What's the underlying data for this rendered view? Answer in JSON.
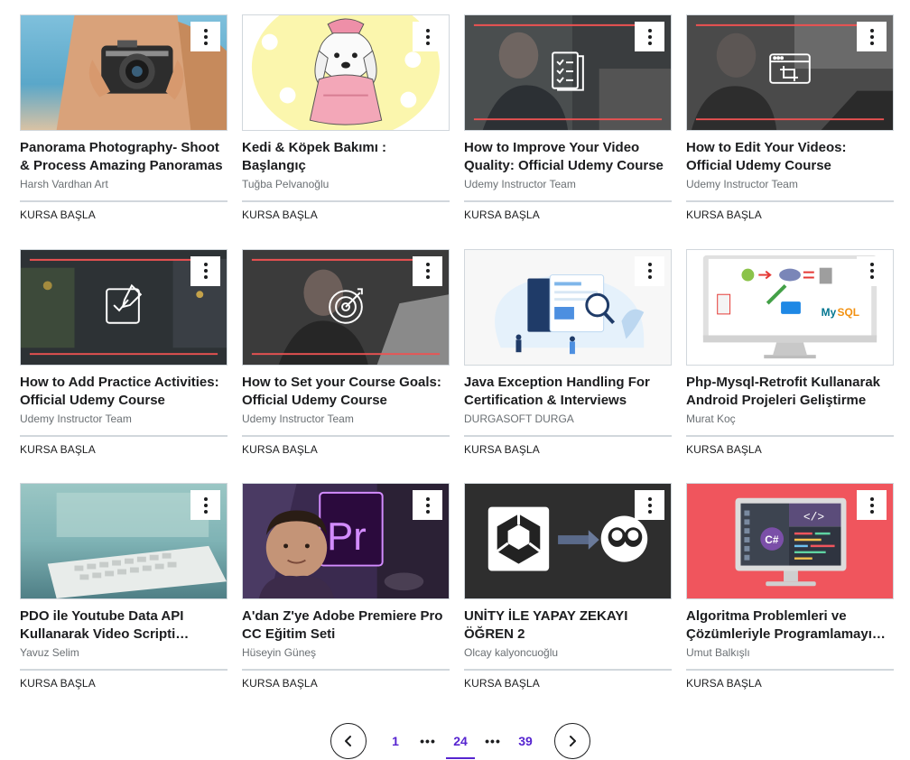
{
  "courses": [
    {
      "title": "Panorama Photography- Shoot & Process Amazing Panoramas",
      "author": "Harsh Vardhan Art",
      "start_label": "KURSA BAŞLA",
      "thumbnail": "camera-photo"
    },
    {
      "title": "Kedi & Köpek Bakımı : Başlangıç",
      "author": "Tuğba Pelvanoğlu",
      "start_label": "KURSA BAŞLA",
      "thumbnail": "dog-illustration"
    },
    {
      "title": "How to Improve Your Video Quality: Official Udemy Course",
      "author": "Udemy Instructor Team",
      "start_label": "KURSA BAŞLA",
      "thumbnail": "checklist-icon"
    },
    {
      "title": "How to Edit Your Videos: Official Udemy Course",
      "author": "Udemy Instructor Team",
      "start_label": "KURSA BAŞLA",
      "thumbnail": "crop-window-icon"
    },
    {
      "title": "How to Add Practice Activities: Official Udemy Course",
      "author": "Udemy Instructor Team",
      "start_label": "KURSA BAŞLA",
      "thumbnail": "edit-note-icon"
    },
    {
      "title": "How to Set your Course Goals: Official Udemy Course",
      "author": "Udemy Instructor Team",
      "start_label": "KURSA BAŞLA",
      "thumbnail": "target-icon"
    },
    {
      "title": "Java Exception Handling For Certification & Interviews",
      "author": "DURGASOFT DURGA",
      "start_label": "KURSA BAŞLA",
      "thumbnail": "search-illustration"
    },
    {
      "title": "Php-Mysql-Retrofit Kullanarak Android Projeleri Geliştirme",
      "author": "Murat Koç",
      "start_label": "KURSA BAŞLA",
      "thumbnail": "php-mysql-diagram"
    },
    {
      "title": "PDO ile Youtube Data API Kullanarak Video Scripti Geliştirme",
      "author": "Yavuz Selim",
      "start_label": "KURSA BAŞLA",
      "thumbnail": "keyboard-photo"
    },
    {
      "title": "A'dan Z'ye Adobe Premiere Pro CC Eğitim Seti",
      "author": "Hüseyin Güneş",
      "start_label": "KURSA BAŞLA",
      "thumbnail": "premiere-logo"
    },
    {
      "title": "UNİTY İLE YAPAY ZEKAYI ÖĞREN 2",
      "author": "Olcay kalyoncuoğlu",
      "start_label": "KURSA BAŞLA",
      "thumbnail": "unity-logo"
    },
    {
      "title": "Algoritma Problemleri ve Çözümleriyle Programlamayı Öğrenin",
      "author": "Umut Balkışlı",
      "start_label": "KURSA BAŞLA",
      "thumbnail": "code-monitor"
    }
  ],
  "pagination": {
    "first": "1",
    "ellipsis": "•••",
    "current": "24",
    "last": "39"
  },
  "colors": {
    "accent": "#5624d0",
    "text": "#1c1d1f",
    "muted": "#6a6f73",
    "udemy_red": "#ec5252"
  }
}
